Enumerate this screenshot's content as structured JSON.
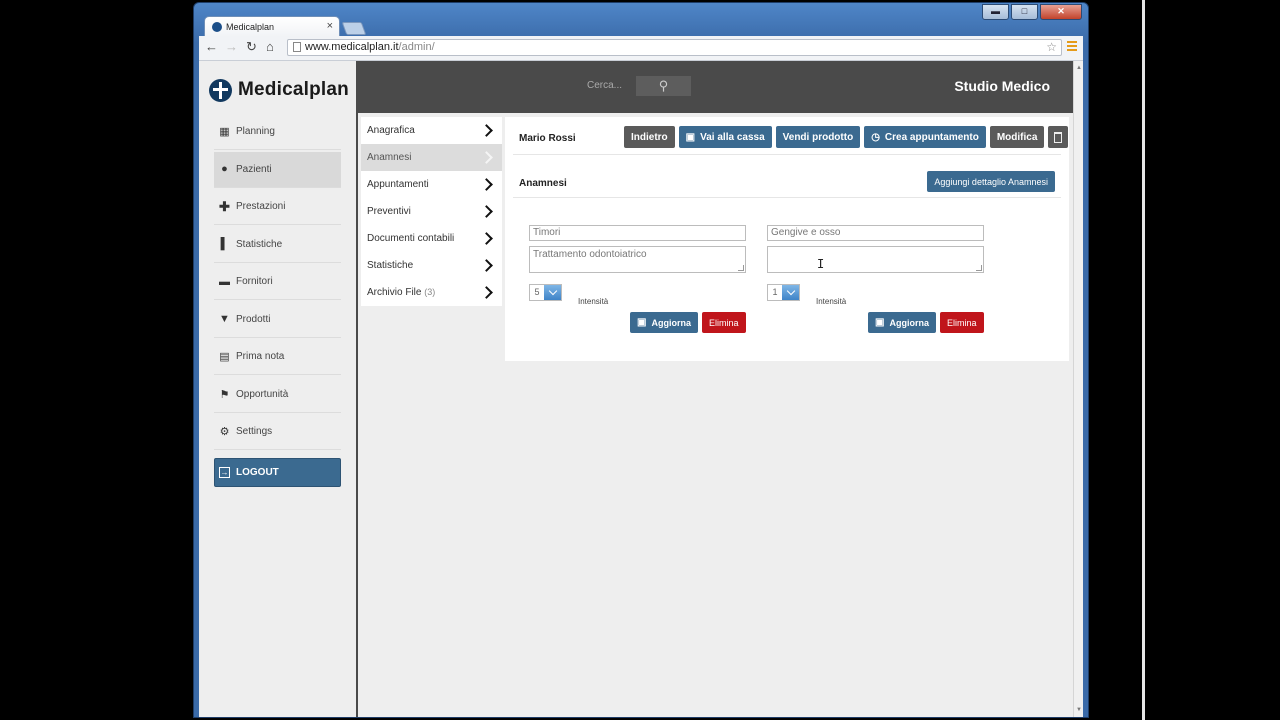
{
  "browser": {
    "tab_title": "Medicalplan",
    "tab_close": "×",
    "url_host": "www.medicalplan.it",
    "url_path": "/admin/",
    "win_min": "▬",
    "win_max": "□",
    "win_close": "✕"
  },
  "sidebar": {
    "brand": "Medicalplan",
    "items": [
      {
        "label": "Planning",
        "icon": "calendar-icon"
      },
      {
        "label": "Pazienti",
        "icon": "user-icon"
      },
      {
        "label": "Prestazioni",
        "icon": "plus-icon"
      },
      {
        "label": "Statistiche",
        "icon": "bar-chart-icon"
      },
      {
        "label": "Fornitori",
        "icon": "truck-icon"
      },
      {
        "label": "Prodotti",
        "icon": "basket-icon"
      },
      {
        "label": "Prima nota",
        "icon": "note-icon"
      },
      {
        "label": "Opportunità",
        "icon": "flag-icon"
      },
      {
        "label": "Settings",
        "icon": "gear-icon"
      }
    ],
    "active_index": 1,
    "logout": "LOGOUT"
  },
  "topbar": {
    "search_placeholder": "Cerca...",
    "studio": "Studio Medico"
  },
  "submenu": {
    "items": [
      {
        "label": "Anagrafica"
      },
      {
        "label": "Anamnesi"
      },
      {
        "label": "Appuntamenti"
      },
      {
        "label": "Preventivi"
      },
      {
        "label": "Documenti contabili"
      },
      {
        "label": "Statistiche"
      },
      {
        "label": "Archivio File",
        "count": "(3)"
      }
    ],
    "active_index": 1
  },
  "patient": {
    "name": "Mario Rossi",
    "actions": {
      "back": "Indietro",
      "cash": "Vai alla cassa",
      "sell": "Vendi prodotto",
      "appointment": "Crea appuntamento",
      "edit": "Modifica"
    }
  },
  "anamnesi": {
    "title": "Anamnesi",
    "add_label": "Aggiungi dettaglio Anamnesi",
    "details": [
      {
        "name": "Timori",
        "notes": "Trattamento odontoiatrico",
        "intensity": "5",
        "intensity_label": "Intensità",
        "save": "Aggiorna",
        "delete": "Elimina"
      },
      {
        "name": "Gengive e osso",
        "notes": "",
        "intensity": "1",
        "intensity_label": "Intensità",
        "save": "Aggiorna",
        "delete": "Elimina"
      }
    ]
  },
  "colors": {
    "accent_blue": "#3b6a90",
    "dark_gray": "#4a4a4a",
    "danger_red": "#c0151b"
  }
}
